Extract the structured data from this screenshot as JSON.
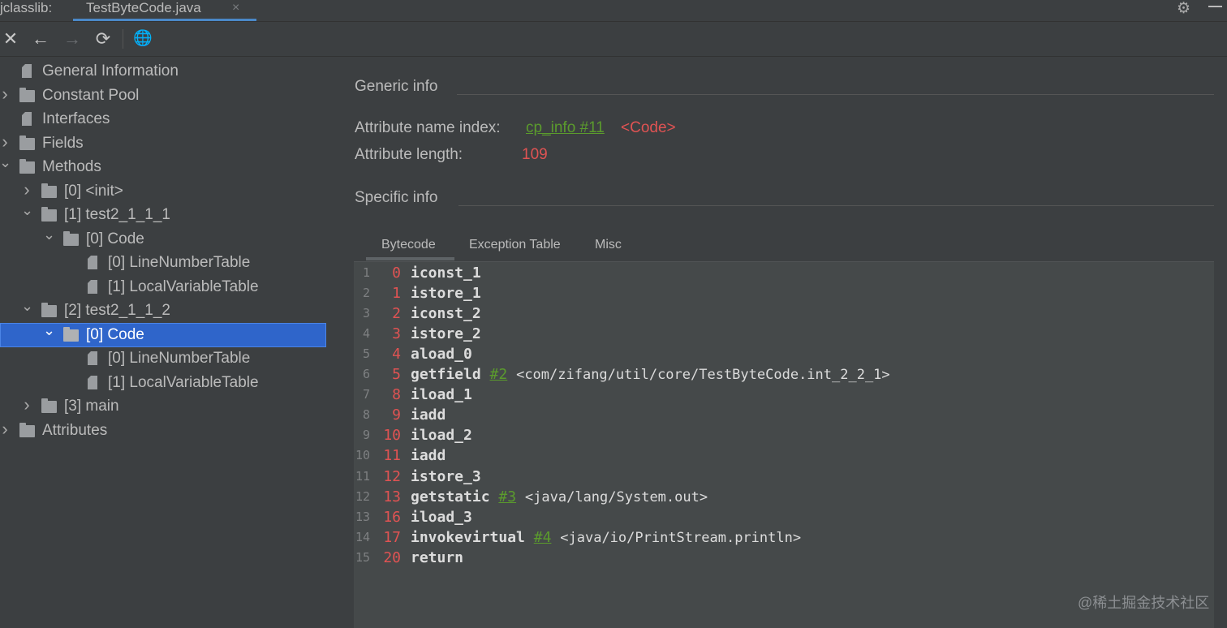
{
  "tabbar": {
    "app_label": "jclasslib:",
    "tab_title": "TestByteCode.java",
    "close_glyph": "×"
  },
  "toolbar": {
    "close": "✕",
    "back": "←",
    "forward": "→",
    "refresh": "⟳",
    "web": "🌐"
  },
  "tree": [
    {
      "label": "General Information",
      "indent": 0,
      "icon": "file",
      "toggle": "none"
    },
    {
      "label": "Constant Pool",
      "indent": 0,
      "icon": "folder",
      "toggle": "collapsed"
    },
    {
      "label": "Interfaces",
      "indent": 0,
      "icon": "file",
      "toggle": "none"
    },
    {
      "label": "Fields",
      "indent": 0,
      "icon": "folder",
      "toggle": "collapsed"
    },
    {
      "label": "Methods",
      "indent": 0,
      "icon": "folder",
      "toggle": "expanded"
    },
    {
      "label": "[0] <init>",
      "indent": 1,
      "icon": "folder",
      "toggle": "collapsed"
    },
    {
      "label": "[1] test2_1_1_1",
      "indent": 1,
      "icon": "folder",
      "toggle": "expanded"
    },
    {
      "label": "[0] Code",
      "indent": 2,
      "icon": "folder",
      "toggle": "expanded"
    },
    {
      "label": "[0] LineNumberTable",
      "indent": 3,
      "icon": "file",
      "toggle": "none"
    },
    {
      "label": "[1] LocalVariableTable",
      "indent": 3,
      "icon": "file",
      "toggle": "none"
    },
    {
      "label": "[2] test2_1_1_2",
      "indent": 1,
      "icon": "folder",
      "toggle": "expanded"
    },
    {
      "label": "[0] Code",
      "indent": 2,
      "icon": "folder",
      "toggle": "expanded",
      "selected": true
    },
    {
      "label": "[0] LineNumberTable",
      "indent": 3,
      "icon": "file",
      "toggle": "none"
    },
    {
      "label": "[1] LocalVariableTable",
      "indent": 3,
      "icon": "file",
      "toggle": "none"
    },
    {
      "label": "[3] main",
      "indent": 1,
      "icon": "folder",
      "toggle": "collapsed"
    },
    {
      "label": "Attributes",
      "indent": 0,
      "icon": "folder",
      "toggle": "collapsed"
    }
  ],
  "generic": {
    "heading": "Generic info",
    "name_index_label": "Attribute name index:",
    "name_index_link": "cp_info #11",
    "name_index_value": "<Code>",
    "length_label": "Attribute length:",
    "length_value": "109"
  },
  "specific": {
    "heading": "Specific info",
    "tabs": [
      "Bytecode",
      "Exception Table",
      "Misc"
    ],
    "active_tab": "Bytecode"
  },
  "bytecode": [
    {
      "line": "1",
      "offset": "0",
      "op": "iconst_1",
      "ref": "",
      "comment": ""
    },
    {
      "line": "2",
      "offset": "1",
      "op": "istore_1",
      "ref": "",
      "comment": ""
    },
    {
      "line": "3",
      "offset": "2",
      "op": "iconst_2",
      "ref": "",
      "comment": ""
    },
    {
      "line": "4",
      "offset": "3",
      "op": "istore_2",
      "ref": "",
      "comment": ""
    },
    {
      "line": "5",
      "offset": "4",
      "op": "aload_0",
      "ref": "",
      "comment": ""
    },
    {
      "line": "6",
      "offset": "5",
      "op": "getfield",
      "ref": "#2",
      "comment": "<com/zifang/util/core/TestByteCode.int_2_2_1>"
    },
    {
      "line": "7",
      "offset": "8",
      "op": "iload_1",
      "ref": "",
      "comment": ""
    },
    {
      "line": "8",
      "offset": "9",
      "op": "iadd",
      "ref": "",
      "comment": ""
    },
    {
      "line": "9",
      "offset": "10",
      "op": "iload_2",
      "ref": "",
      "comment": ""
    },
    {
      "line": "10",
      "offset": "11",
      "op": "iadd",
      "ref": "",
      "comment": ""
    },
    {
      "line": "11",
      "offset": "12",
      "op": "istore_3",
      "ref": "",
      "comment": ""
    },
    {
      "line": "12",
      "offset": "13",
      "op": "getstatic",
      "ref": "#3",
      "comment": "<java/lang/System.out>"
    },
    {
      "line": "13",
      "offset": "16",
      "op": "iload_3",
      "ref": "",
      "comment": ""
    },
    {
      "line": "14",
      "offset": "17",
      "op": "invokevirtual",
      "ref": "#4",
      "comment": "<java/io/PrintStream.println>"
    },
    {
      "line": "15",
      "offset": "20",
      "op": "return",
      "ref": "",
      "comment": ""
    }
  ],
  "watermark": "@稀土掘金技术社区",
  "colors": {
    "background": "#3c3f41",
    "selection": "#2f65ca",
    "tab_underline": "#4a88c7",
    "red_value": "#e05353",
    "green_link": "#5b9b2d"
  }
}
